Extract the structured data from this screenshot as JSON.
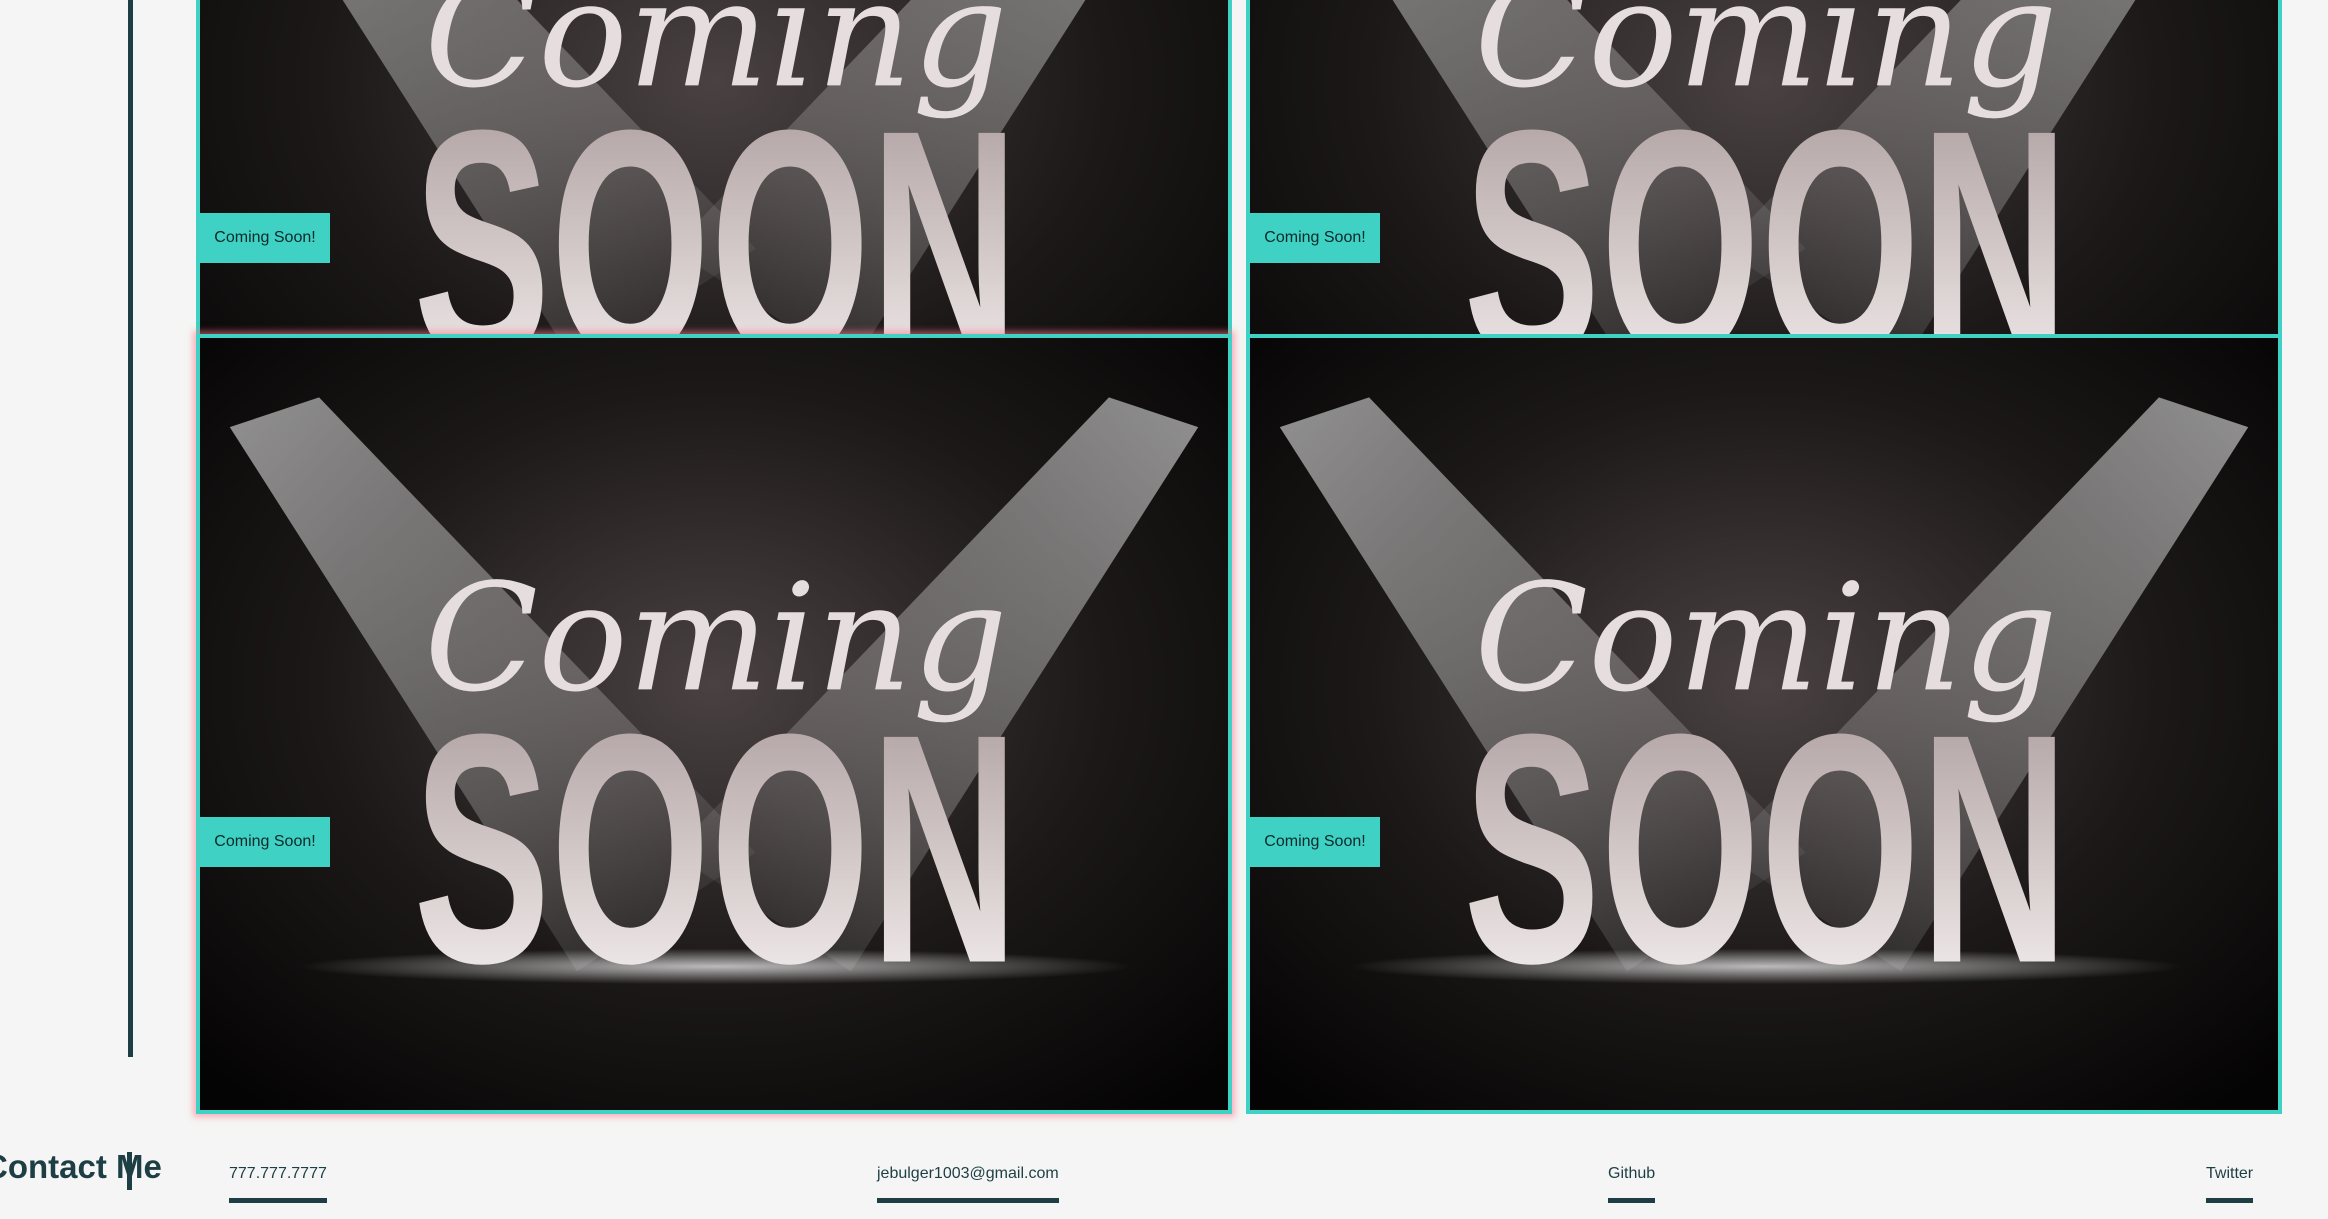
{
  "projects": [
    {
      "badge": "Coming Soon!",
      "script_word": "Coming",
      "block_word": "SOON",
      "highlighted": false
    },
    {
      "badge": "Coming Soon!",
      "script_word": "Coming",
      "block_word": "SOON",
      "highlighted": false
    },
    {
      "badge": "Coming Soon!",
      "script_word": "Coming",
      "block_word": "SOON",
      "highlighted": true
    },
    {
      "badge": "Coming Soon!",
      "script_word": "Coming",
      "block_word": "SOON",
      "highlighted": false
    }
  ],
  "contact": {
    "heading": "Contact Me",
    "phone": "777.777.7777",
    "email": "jebulger1003@gmail.com",
    "github": "Github",
    "twitter": "Twitter"
  },
  "colors": {
    "accent": "#3fd1c3",
    "dark": "#1d3e45",
    "background": "#f4f5f4",
    "hover_glow": "#ff7890"
  }
}
